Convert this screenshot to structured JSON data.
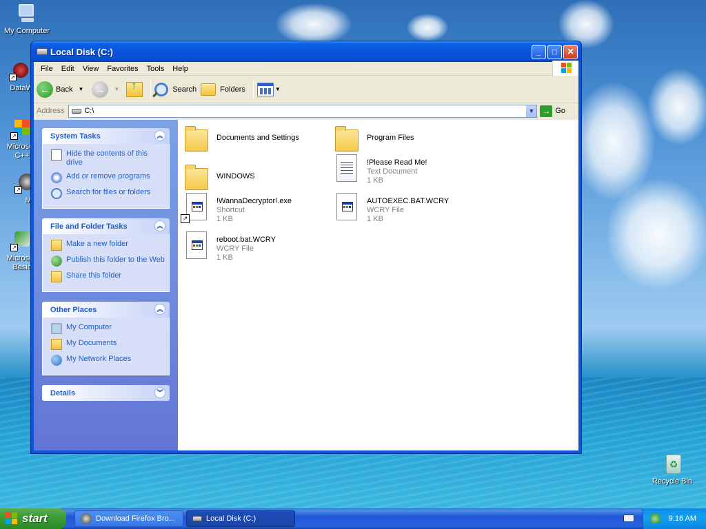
{
  "desktop": {
    "icons": [
      {
        "label": "My Computer"
      },
      {
        "label": "DataWa"
      },
      {
        "label": "Microsoft C++"
      },
      {
        "label": "Myp"
      },
      {
        "label": "Microsoft Basic"
      },
      {
        "label": "Recycle Bin"
      }
    ]
  },
  "window": {
    "title": "Local Disk (C:)",
    "menu": [
      "File",
      "Edit",
      "View",
      "Favorites",
      "Tools",
      "Help"
    ],
    "toolbar": {
      "back": "Back",
      "search": "Search",
      "folders": "Folders"
    },
    "address": {
      "label": "Address",
      "value": "C:\\",
      "go": "Go"
    }
  },
  "tasks": {
    "system": {
      "title": "System Tasks",
      "items": [
        "Hide the contents of this drive",
        "Add or remove programs",
        "Search for files or folders"
      ]
    },
    "file_folder": {
      "title": "File and Folder Tasks",
      "items": [
        "Make a new folder",
        "Publish this folder to the Web",
        "Share this folder"
      ]
    },
    "other_places": {
      "title": "Other Places",
      "items": [
        "My Computer",
        "My Documents",
        "My Network Places"
      ]
    },
    "details": {
      "title": "Details"
    }
  },
  "files": [
    {
      "name": "Documents and Settings",
      "type": "",
      "size": "",
      "icon": "folder-icon"
    },
    {
      "name": "Program Files",
      "type": "",
      "size": "",
      "icon": "folder-icon"
    },
    {
      "name": "WINDOWS",
      "type": "",
      "size": "",
      "icon": "folder-icon"
    },
    {
      "name": "!Please Read Me!",
      "type": "Text Document",
      "size": "1 KB",
      "icon": "text-document-icon"
    },
    {
      "name": "!WannaDecryptor!.exe",
      "type": "Shortcut",
      "size": "1 KB",
      "icon": "shortcut-icon"
    },
    {
      "name": "AUTOEXEC.BAT.WCRY",
      "type": "WCRY File",
      "size": "1 KB",
      "icon": "wcry-file-icon"
    },
    {
      "name": "reboot.bat.WCRY",
      "type": "WCRY File",
      "size": "1 KB",
      "icon": "wcry-file-icon"
    }
  ],
  "taskbar": {
    "start": "start",
    "items": [
      "Download Firefox Bro...",
      "Local Disk (C:)"
    ],
    "clock": "9:16 AM"
  },
  "colors": {
    "accent": "#215dc6",
    "titlebar": "#0a53db",
    "start": "#3c9d36"
  }
}
